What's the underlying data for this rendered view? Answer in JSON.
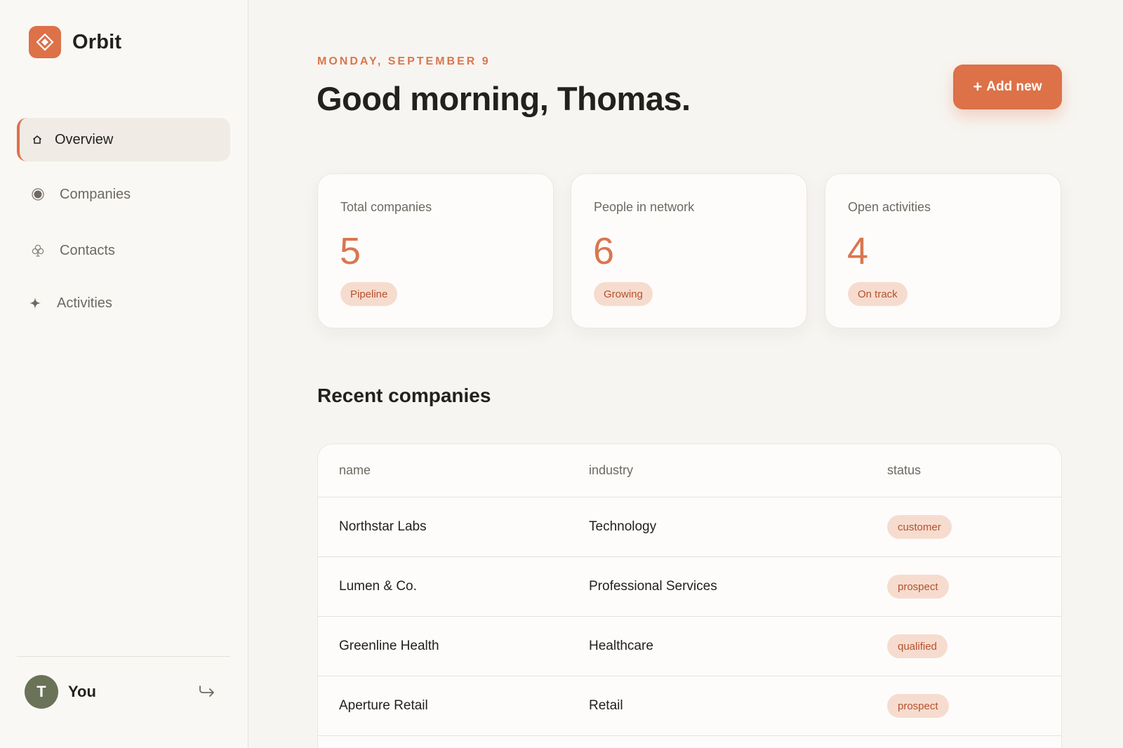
{
  "app": {
    "name": "Orbit",
    "accent": "#dd7148"
  },
  "sidebar": {
    "items": [
      {
        "label": "Overview",
        "icon": "home-icon",
        "active": true
      },
      {
        "label": "Companies",
        "icon": "radio-dot-icon",
        "active": false
      },
      {
        "label": "Contacts",
        "icon": "club-icon",
        "active": false
      },
      {
        "label": "Activities",
        "icon": "sparkle-icon",
        "active": false
      }
    ],
    "user": {
      "initial": "T",
      "name": "You"
    }
  },
  "header": {
    "date": "MONDAY, SEPTEMBER 9",
    "greeting": "Good morning, Thomas.",
    "add_button": "+ Add new",
    "add_button_text": "Add new"
  },
  "stats": [
    {
      "title": "Total companies",
      "value": "5",
      "badge": "Pipeline"
    },
    {
      "title": "People in network",
      "value": "6",
      "badge": "Growing"
    },
    {
      "title": "Open activities",
      "value": "4",
      "badge": "On track"
    }
  ],
  "recent": {
    "title": "Recent companies",
    "columns": [
      "name",
      "industry",
      "status"
    ],
    "rows": [
      {
        "name": "Northstar Labs",
        "industry": "Technology",
        "status": "customer"
      },
      {
        "name": "Lumen & Co.",
        "industry": "Professional Services",
        "status": "prospect"
      },
      {
        "name": "Greenline Health",
        "industry": "Healthcare",
        "status": "qualified"
      },
      {
        "name": "Aperture Retail",
        "industry": "Retail",
        "status": "prospect"
      }
    ]
  }
}
